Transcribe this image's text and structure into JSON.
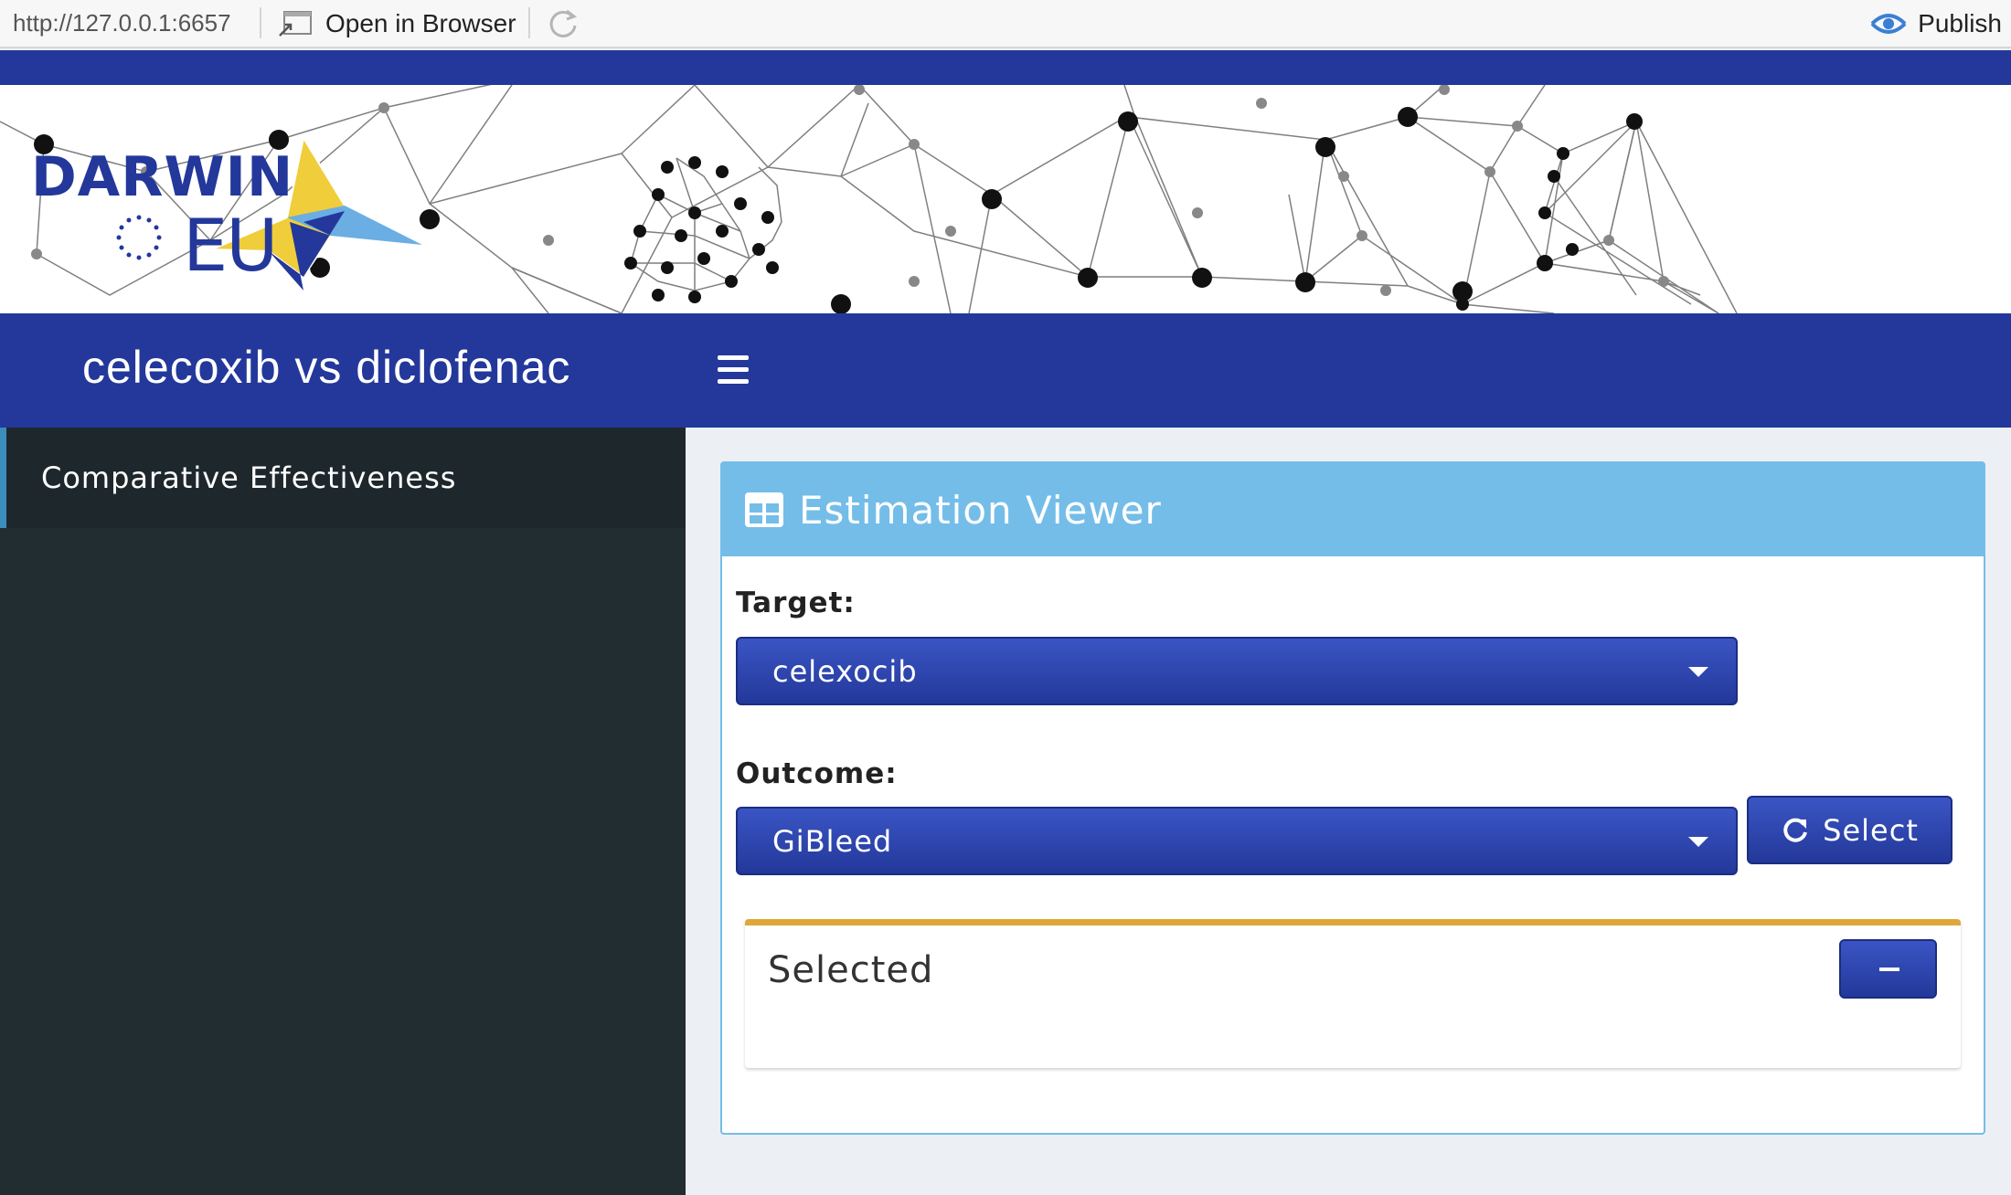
{
  "toolbar": {
    "url": "http://127.0.0.1:6657",
    "open_in_browser": "Open in Browser",
    "publish": "Publish"
  },
  "header": {
    "logo_line1": "DARWIN",
    "logo_line2": "EU",
    "app_title": "celecoxib vs diclofenac"
  },
  "sidebar": {
    "items": [
      {
        "label": "Comparative Effectiveness",
        "active": true
      }
    ]
  },
  "main": {
    "box_title": "Estimation Viewer",
    "target_label": "Target:",
    "target_value": "celexocib",
    "outcome_label": "Outcome:",
    "outcome_value": "GiBleed",
    "select_button": "Select",
    "selected_title": "Selected"
  },
  "colors": {
    "brand_blue": "#23389a",
    "box_header": "#74bde9",
    "sidebar_bg": "#222d32",
    "accent_orange": "#e0a63a",
    "logo_yellow": "#f0cd3a",
    "logo_light_blue": "#6aaee3"
  },
  "icons": [
    "open-in-browser-icon",
    "refresh-icon",
    "publish-icon",
    "hamburger-menu-icon",
    "table-grid-icon",
    "refresh-circle-icon",
    "minus-icon",
    "chevron-down-icon"
  ]
}
